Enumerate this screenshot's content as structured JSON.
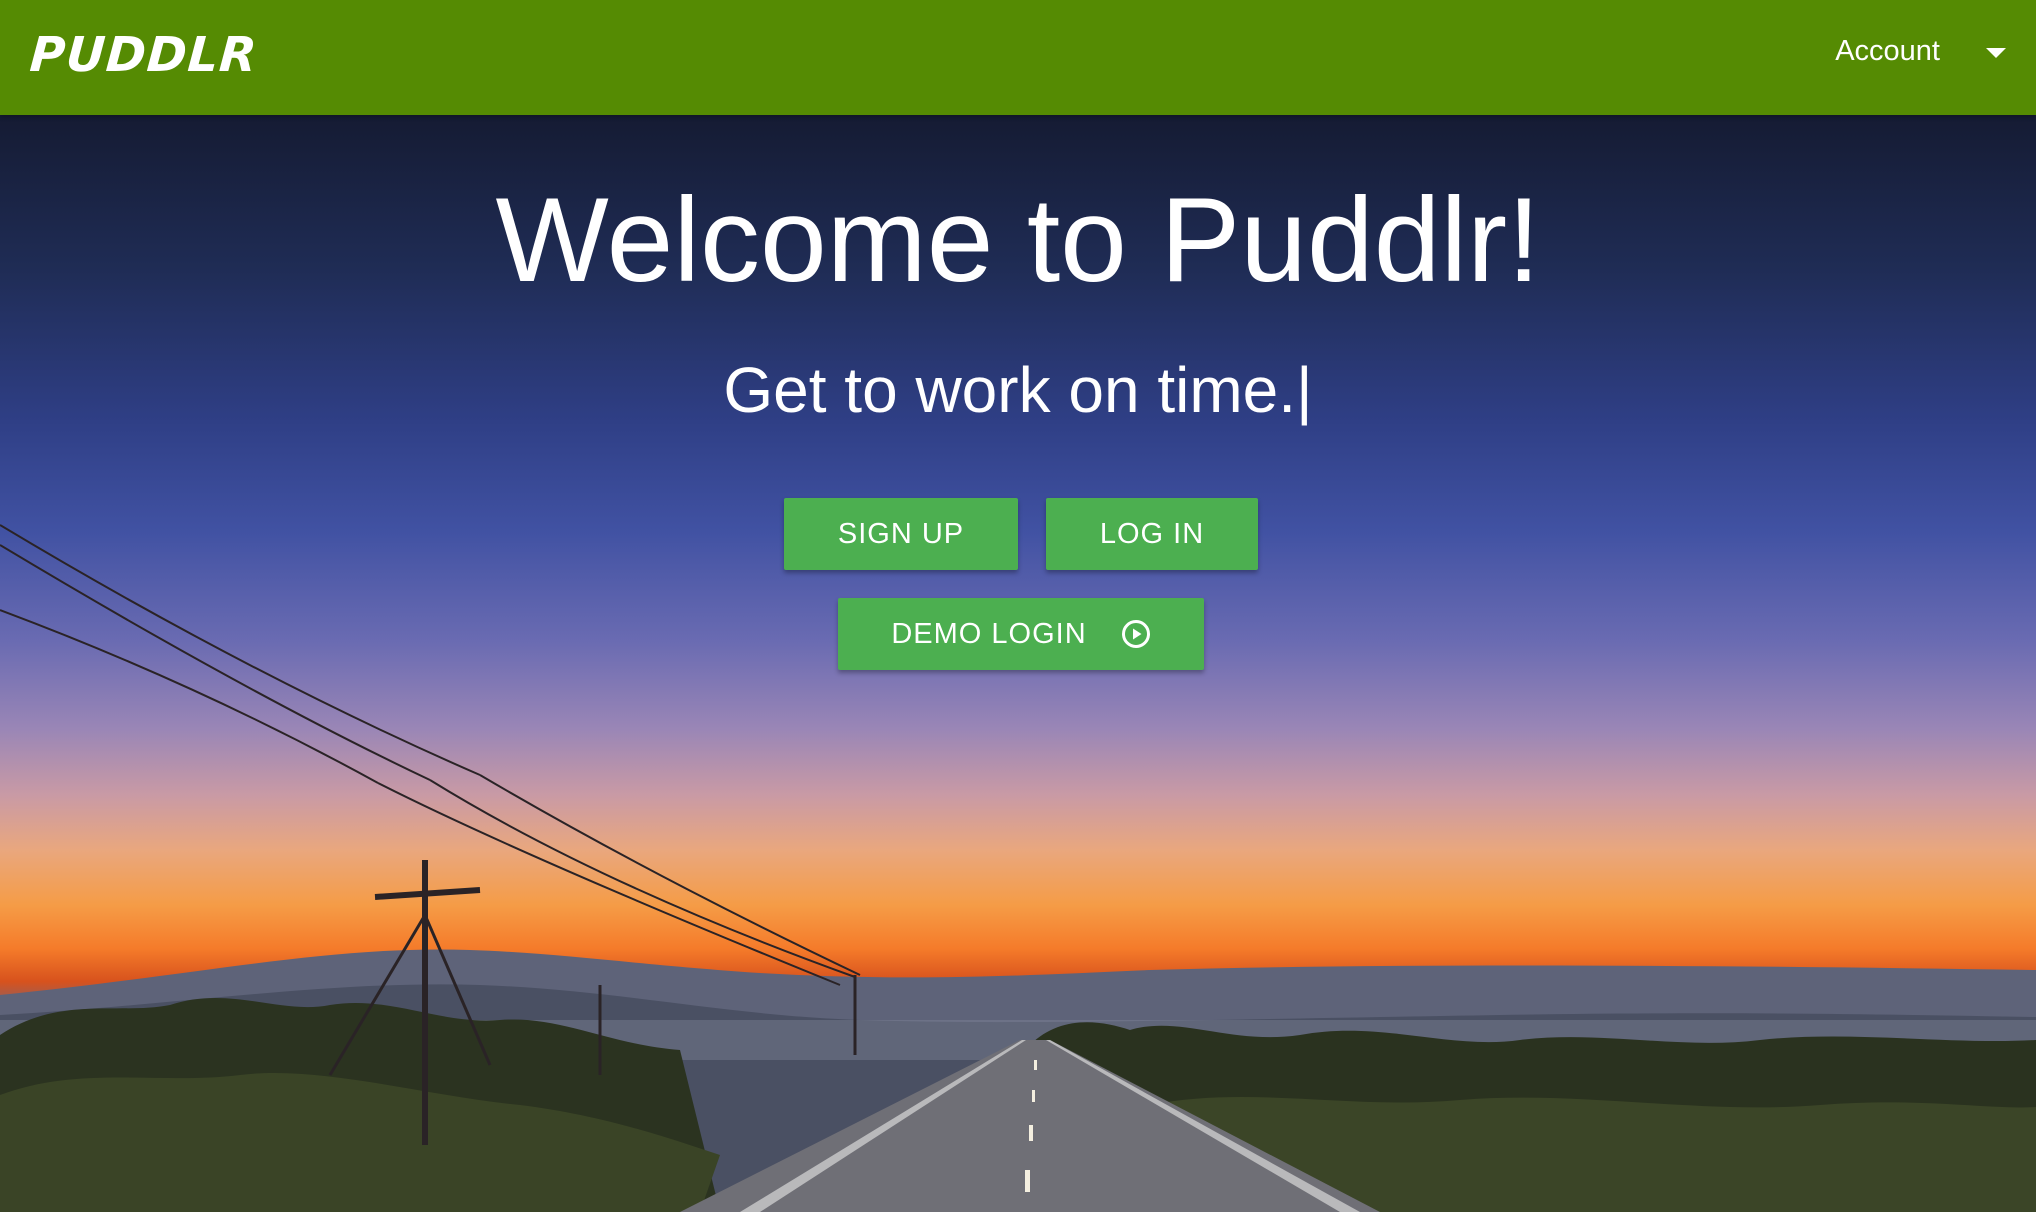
{
  "header": {
    "logo_text": "PUDDLR",
    "account_label": "Account",
    "account_icon": "chevron-down-icon",
    "bar_color": "#558b03"
  },
  "hero": {
    "title": "Welcome to Puddlr!",
    "tagline": "Get to work on time.|",
    "background_scene": "dusk-road-landscape"
  },
  "buttons": {
    "signup_label": "SIGN UP",
    "login_label": "LOG IN",
    "demo_label": "DEMO LOGIN",
    "demo_icon": "play-circle-icon",
    "color": "#4caf50"
  }
}
